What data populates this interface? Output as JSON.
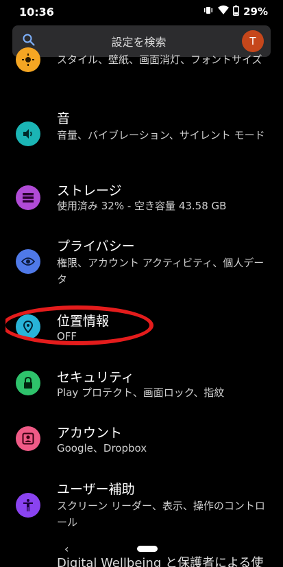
{
  "status": {
    "time": "10:36",
    "battery": "29%"
  },
  "search": {
    "placeholder": "設定を検索",
    "avatar_letter": "T"
  },
  "colors": {
    "display": "#f5a623",
    "sound": "#1bb5b5",
    "storage": "#b04bd6",
    "privacy": "#4f79e8",
    "location": "#28b4d8",
    "security": "#2ec26b",
    "accounts": "#ef5a86",
    "accessibility": "#8a43f0",
    "highlight": "#e41c1c"
  },
  "items": [
    {
      "title": "",
      "subtitle": "スタイル、壁紙、画面消灯、フォントサイズ"
    },
    {
      "title": "音",
      "subtitle": "音量、バイブレーション、サイレント モード"
    },
    {
      "title": "ストレージ",
      "subtitle": "使用済み 32% - 空き容量 43.58 GB"
    },
    {
      "title": "プライバシー",
      "subtitle": "権限、アカウント アクティビティ、個人データ"
    },
    {
      "title": "位置情報",
      "subtitle": "OFF"
    },
    {
      "title": "セキュリティ",
      "subtitle": "Play プロテクト、画面ロック、指紋"
    },
    {
      "title": "アカウント",
      "subtitle": "Google、Dropbox"
    },
    {
      "title": "ユーザー補助",
      "subtitle": "スクリーン リーダー、表示、操作のコントロール"
    }
  ],
  "bottom_item_title": "Digital Wellbeing と保護者による使",
  "nav": {
    "back": "‹"
  }
}
